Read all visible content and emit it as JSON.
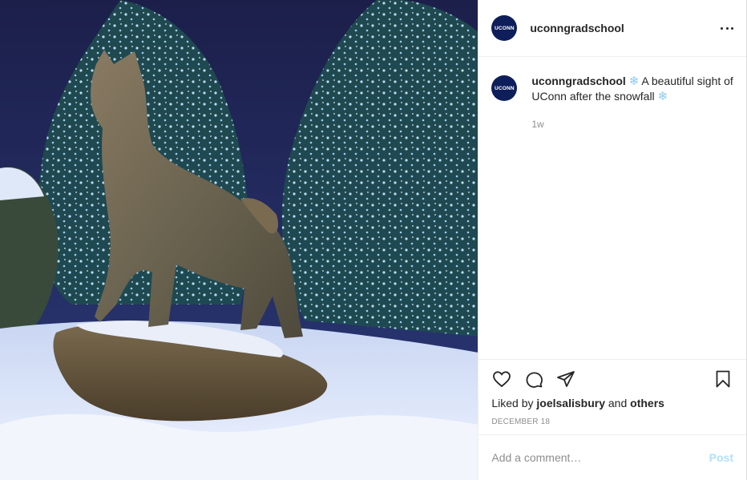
{
  "post": {
    "account": {
      "avatar_text": "UCONN",
      "username": "uconngradschool"
    },
    "menu_icon": "more-horizontal-icon",
    "caption": {
      "username": "uconngradschool",
      "emoji": "❄",
      "text": "A beautiful sight of UConn after the snowfall",
      "age": "1w"
    },
    "actions": {
      "icons": [
        "heart-icon",
        "comment-icon",
        "share-icon",
        "bookmark-icon"
      ]
    },
    "likes": {
      "prefix": "Liked by",
      "user": "joelsalisbury",
      "joiner": "and",
      "others": "others"
    },
    "date": "DECEMBER 18",
    "comment": {
      "placeholder": "Add a comment…",
      "post_label": "Post"
    },
    "colors": {
      "brand_navy": "#0e1e5b",
      "post_button": "#b2dffc",
      "muted": "#8e8e8e"
    }
  }
}
